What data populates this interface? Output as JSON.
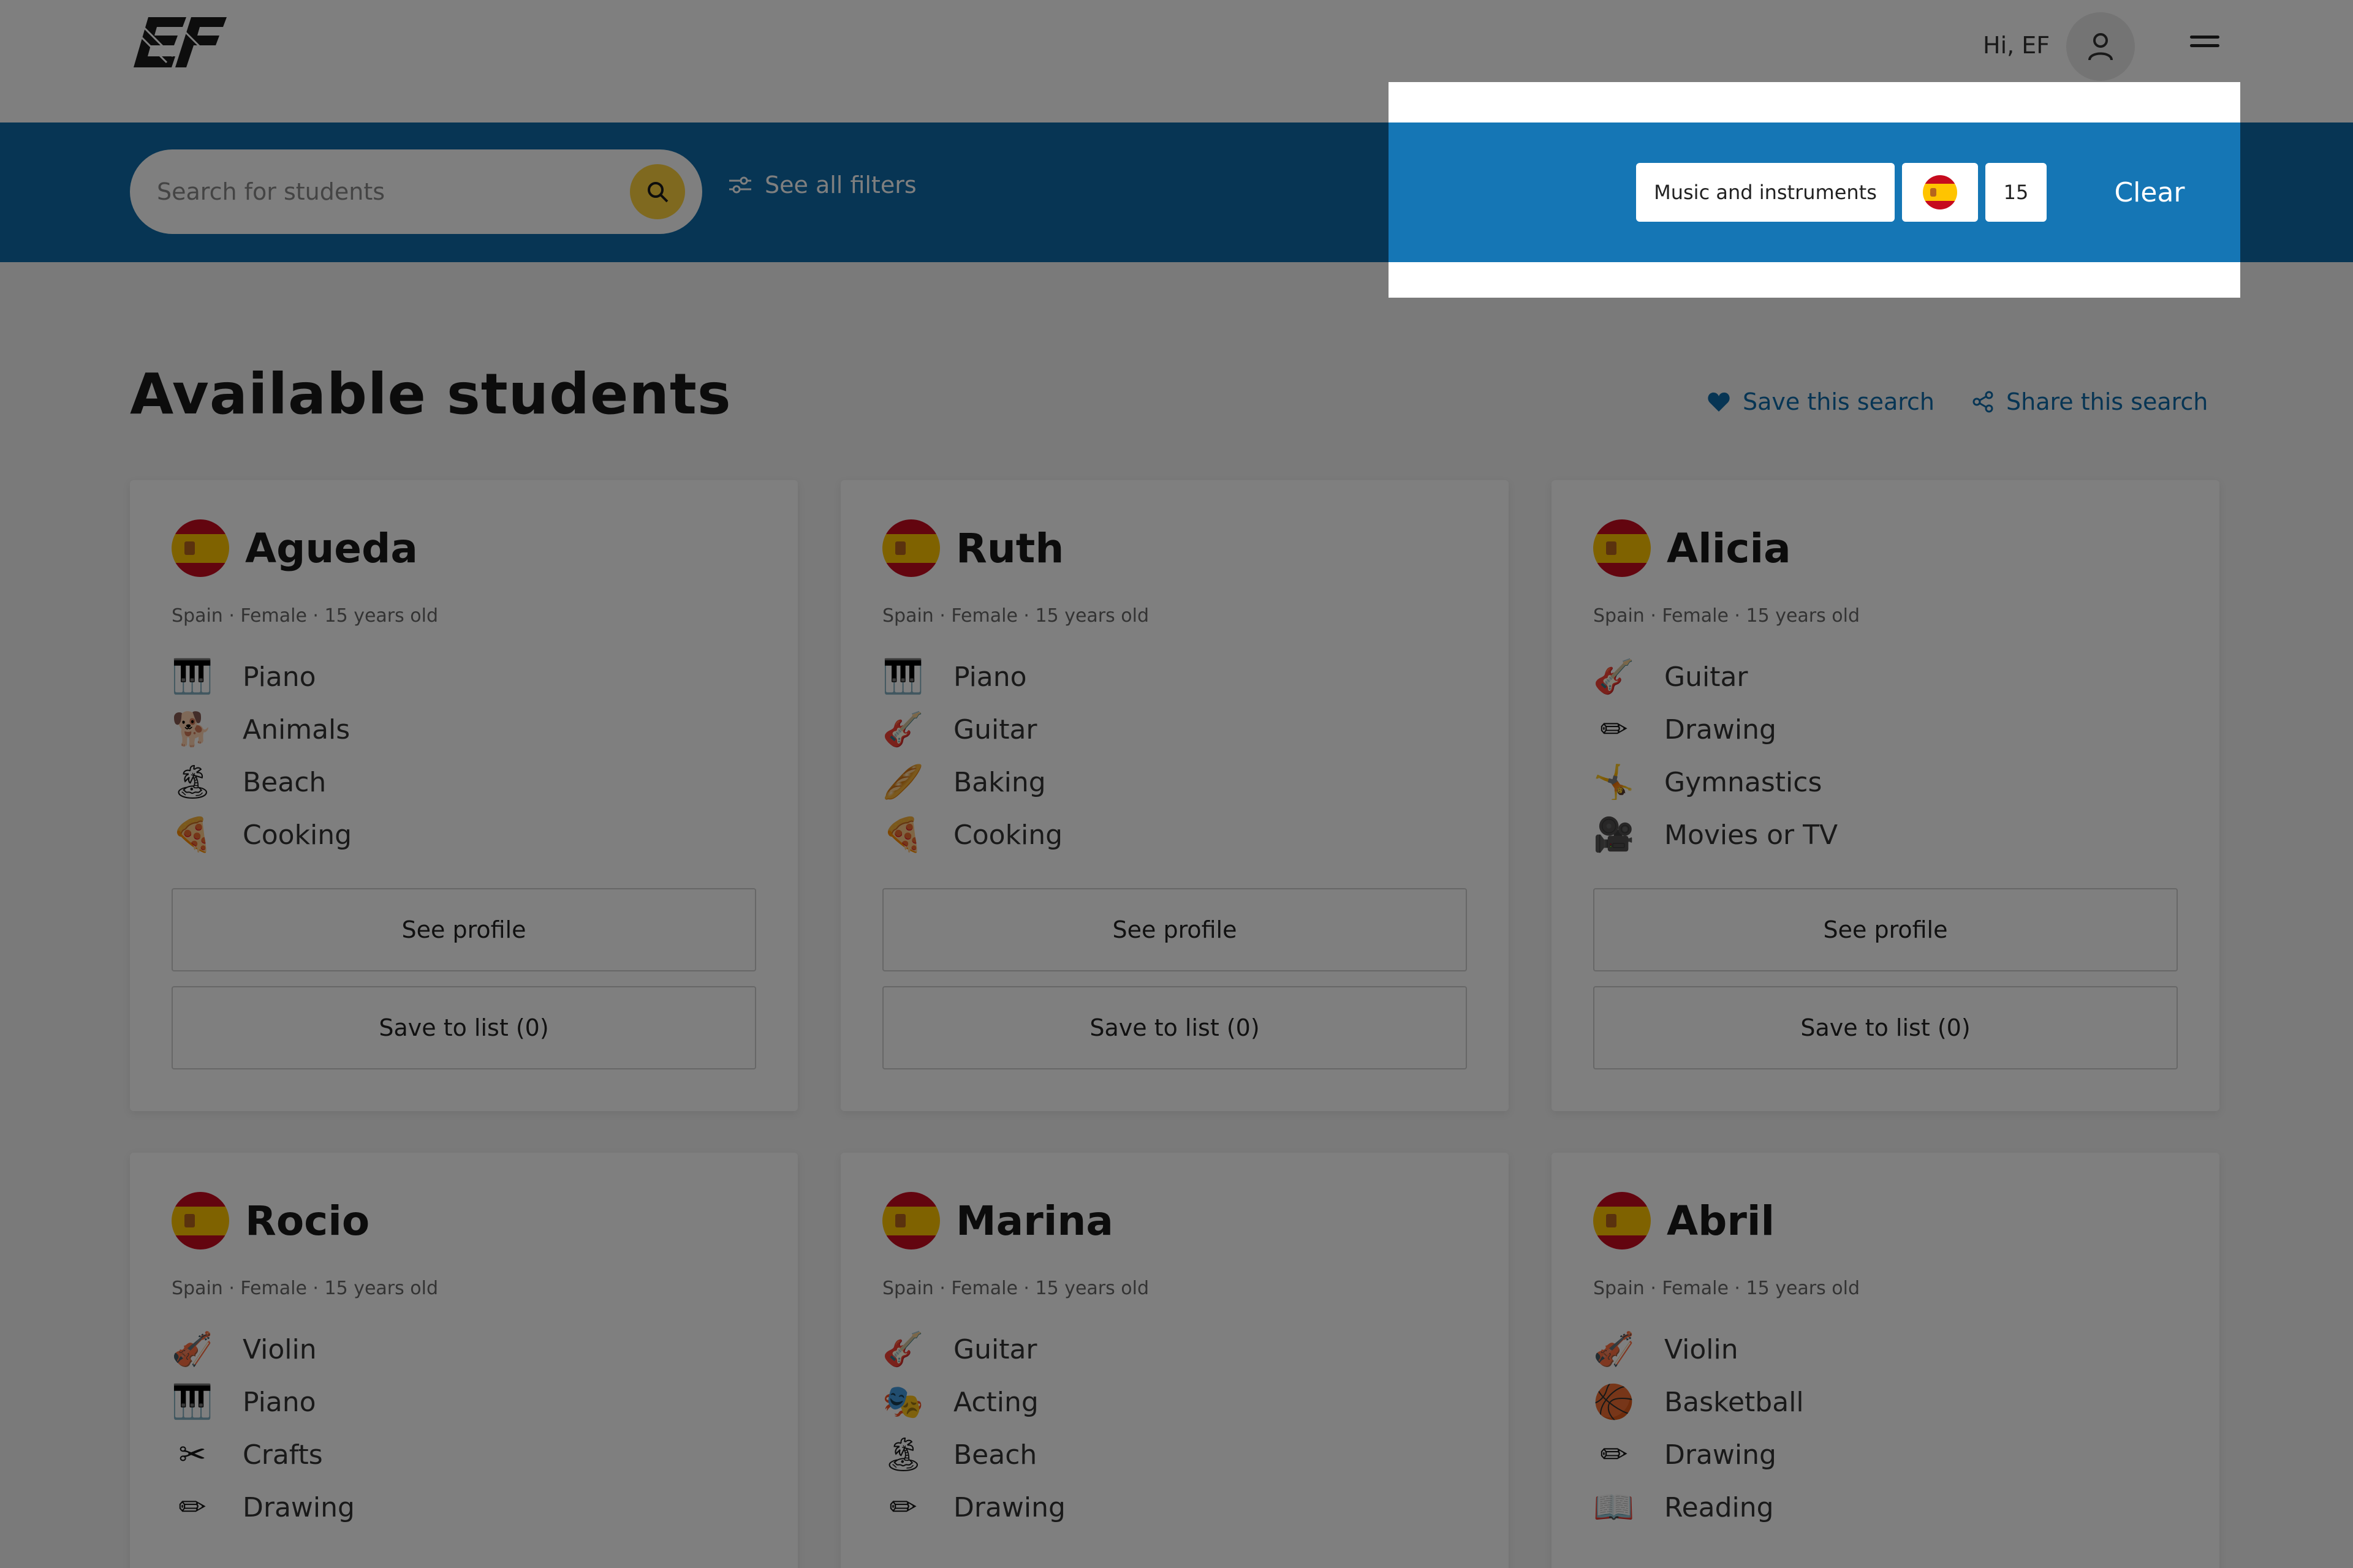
{
  "header": {
    "greeting": "Hi, EF"
  },
  "search": {
    "placeholder": "Search for students",
    "see_filters_label": "See all filters"
  },
  "active_filters": {
    "chips": [
      "Music and instruments",
      "15"
    ],
    "clear_label": "Clear"
  },
  "page": {
    "title": "Available students",
    "save_search_label": "Save this search",
    "share_search_label": "Share this search"
  },
  "colors": {
    "brand_blue": "#0e6aa8",
    "accent_yellow": "#ffd23f"
  },
  "students": [
    {
      "name": "Agueda",
      "meta": "Spain · Female · 15 years old",
      "interests": [
        {
          "icon": "piano-icon",
          "glyph": "🎹",
          "label": "Piano"
        },
        {
          "icon": "animals-icon",
          "glyph": "🐕",
          "label": "Animals"
        },
        {
          "icon": "beach-icon",
          "glyph": "🏝",
          "label": "Beach"
        },
        {
          "icon": "cooking-icon",
          "glyph": "🍕",
          "label": "Cooking"
        }
      ],
      "see_profile": "See profile",
      "save_to_list": "Save to list (0)"
    },
    {
      "name": "Ruth",
      "meta": "Spain · Female · 15 years old",
      "interests": [
        {
          "icon": "piano-icon",
          "glyph": "🎹",
          "label": "Piano"
        },
        {
          "icon": "guitar-icon",
          "glyph": "🎸",
          "label": "Guitar"
        },
        {
          "icon": "baking-icon",
          "glyph": "🥖",
          "label": "Baking"
        },
        {
          "icon": "cooking-icon",
          "glyph": "🍕",
          "label": "Cooking"
        }
      ],
      "see_profile": "See profile",
      "save_to_list": "Save to list (0)"
    },
    {
      "name": "Alicia",
      "meta": "Spain · Female · 15 years old",
      "interests": [
        {
          "icon": "guitar-icon",
          "glyph": "🎸",
          "label": "Guitar"
        },
        {
          "icon": "drawing-icon",
          "glyph": "✏",
          "label": "Drawing"
        },
        {
          "icon": "gymnastics-icon",
          "glyph": "🤸",
          "label": "Gymnastics"
        },
        {
          "icon": "movies-icon",
          "glyph": "🎥",
          "label": "Movies or TV"
        }
      ],
      "see_profile": "See profile",
      "save_to_list": "Save to list (0)"
    },
    {
      "name": "Rocio",
      "meta": "Spain · Female · 15 years old",
      "interests": [
        {
          "icon": "violin-icon",
          "glyph": "🎻",
          "label": "Violin"
        },
        {
          "icon": "piano-icon",
          "glyph": "🎹",
          "label": "Piano"
        },
        {
          "icon": "crafts-icon",
          "glyph": "✂",
          "label": "Crafts"
        },
        {
          "icon": "drawing-icon",
          "glyph": "✏",
          "label": "Drawing"
        }
      ]
    },
    {
      "name": "Marina",
      "meta": "Spain · Female · 15 years old",
      "interests": [
        {
          "icon": "guitar-icon",
          "glyph": "🎸",
          "label": "Guitar"
        },
        {
          "icon": "acting-icon",
          "glyph": "🎭",
          "label": "Acting"
        },
        {
          "icon": "beach-icon",
          "glyph": "🏝",
          "label": "Beach"
        },
        {
          "icon": "drawing-icon",
          "glyph": "✏",
          "label": "Drawing"
        }
      ]
    },
    {
      "name": "Abril",
      "meta": "Spain · Female · 15 years old",
      "interests": [
        {
          "icon": "violin-icon",
          "glyph": "🎻",
          "label": "Violin"
        },
        {
          "icon": "basketball-icon",
          "glyph": "🏀",
          "label": "Basketball"
        },
        {
          "icon": "drawing-icon",
          "glyph": "✏",
          "label": "Drawing"
        },
        {
          "icon": "reading-icon",
          "glyph": "📖",
          "label": "Reading"
        }
      ]
    }
  ]
}
